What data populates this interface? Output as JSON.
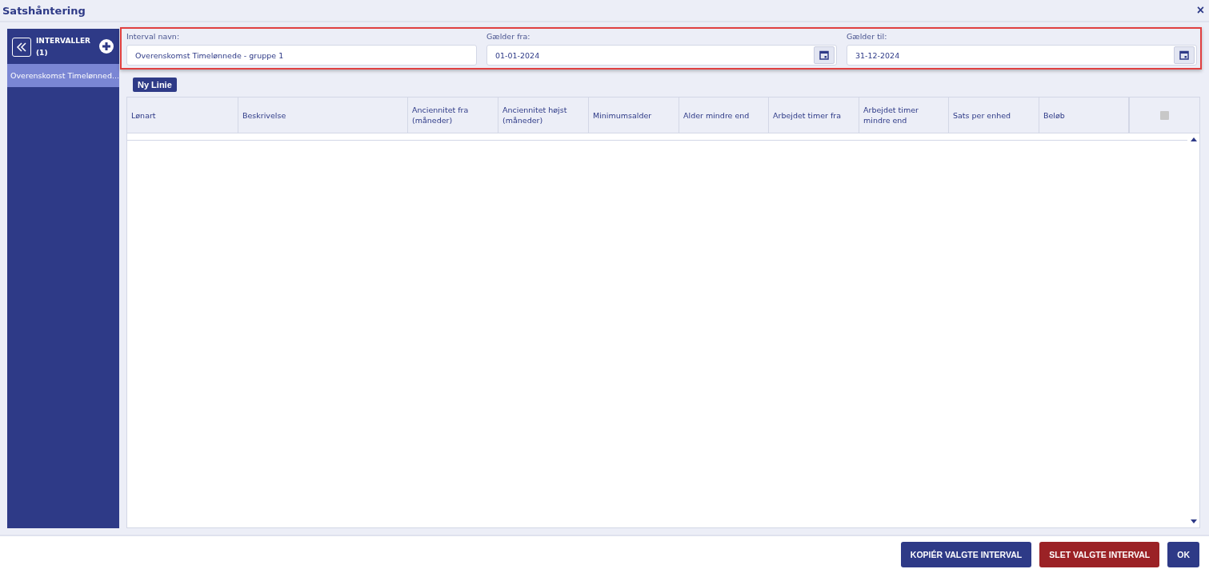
{
  "window": {
    "title": "Satshåntering",
    "close": "×"
  },
  "sidebar": {
    "title": "INTERVALLER",
    "count": "(1)",
    "items": [
      {
        "label": "Overenskomst Timelønned...",
        "selected": true
      }
    ]
  },
  "fields": [
    {
      "kind": "text",
      "label": "Interval navn:",
      "value": "Overenskomst Timelønnede - gruppe 1"
    },
    {
      "kind": "date",
      "label": "Gælder fra:",
      "value": "01-01-2024"
    },
    {
      "kind": "date",
      "label": "Gælder til:",
      "value": "31-12-2024"
    }
  ],
  "new_line_button": "Ny Linie",
  "table": {
    "columns": [
      "Lønart",
      "Beskrivelse",
      "Anciennitet fra (måneder)",
      "Anciennitet højst (måneder)",
      "Minimumsalder",
      "Alder mindre end",
      "Arbejdet timer fra",
      "Arbejdet timer mindre end",
      "Sats per enhed",
      "Beløb"
    ],
    "select_all": {
      "checked": false
    }
  },
  "buttons": [
    {
      "label": "KOPIÉR VALGTE INTERVAL",
      "kind": "primary"
    },
    {
      "label": "SLET VALGTE INTERVAL",
      "kind": "danger"
    },
    {
      "label": "OK",
      "kind": "primary"
    }
  ]
}
